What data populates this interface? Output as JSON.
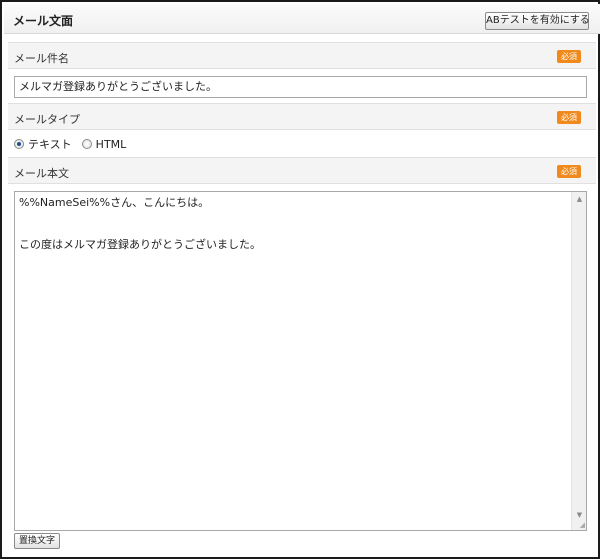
{
  "panel": {
    "title": "メール文面",
    "ab_test_button": "ABテストを有効にする"
  },
  "subject": {
    "label": "メール件名",
    "required_badge": "必須",
    "value": "メルマガ登録ありがとうございました。"
  },
  "mail_type": {
    "label": "メールタイプ",
    "required_badge": "必須",
    "options": [
      {
        "label": "テキスト",
        "selected": true
      },
      {
        "label": "HTML",
        "selected": false
      }
    ]
  },
  "body": {
    "label": "メール本文",
    "required_badge": "必須",
    "value": "%%NameSei%%さん、こんにちは。\n\n\nこの度はメルマガ登録ありがとうございました。"
  },
  "replace_button": "置換文字",
  "colors": {
    "required_badge": "#f08a1c",
    "frame_border": "#1a1a1a"
  }
}
